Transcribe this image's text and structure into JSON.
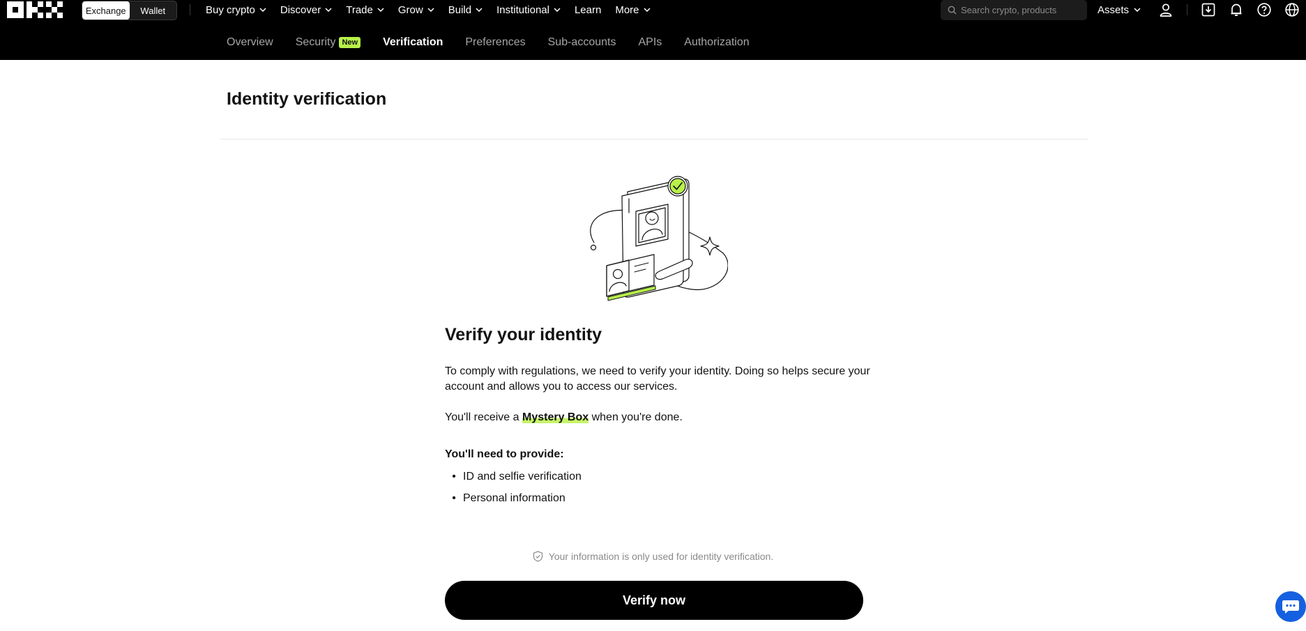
{
  "header": {
    "logo_text": "OKX",
    "mode_switch": [
      {
        "label": "Exchange",
        "active": true
      },
      {
        "label": "Wallet",
        "active": false
      }
    ],
    "nav": [
      {
        "label": "Buy crypto",
        "dropdown": true
      },
      {
        "label": "Discover",
        "dropdown": true
      },
      {
        "label": "Trade",
        "dropdown": true
      },
      {
        "label": "Grow",
        "dropdown": true
      },
      {
        "label": "Build",
        "dropdown": true
      },
      {
        "label": "Institutional",
        "dropdown": true
      },
      {
        "label": "Learn",
        "dropdown": false
      },
      {
        "label": "More",
        "dropdown": true
      }
    ],
    "search_placeholder": "Search crypto, products",
    "assets_label": "Assets",
    "icons": [
      "user-icon",
      "download-icon",
      "bell-icon",
      "help-icon",
      "globe-icon"
    ]
  },
  "subnav": {
    "tabs": [
      {
        "label": "Overview",
        "active": false
      },
      {
        "label": "Security",
        "active": false,
        "badge": "New"
      },
      {
        "label": "Verification",
        "active": true
      },
      {
        "label": "Preferences",
        "active": false
      },
      {
        "label": "Sub-accounts",
        "active": false
      },
      {
        "label": "APIs",
        "active": false
      },
      {
        "label": "Authorization",
        "active": false
      }
    ]
  },
  "page": {
    "title": "Identity verification",
    "verify_title": "Verify your identity",
    "description": "To comply with regulations, we need to verify your identity. Doing so helps secure your account and allows you to access our services.",
    "reward_prefix": "You'll receive a ",
    "reward_highlight": "Mystery Box",
    "reward_suffix": " when you're done.",
    "need_title": "You'll need to provide:",
    "requirements": [
      "ID and selfie verification",
      "Personal information"
    ],
    "privacy_note": "Your information is only used for identity verification.",
    "verify_button": "Verify now"
  },
  "colors": {
    "accent": "#b8f14a",
    "topbar": "#000000",
    "button": "#000000",
    "chat_fab": "#1560e0"
  }
}
